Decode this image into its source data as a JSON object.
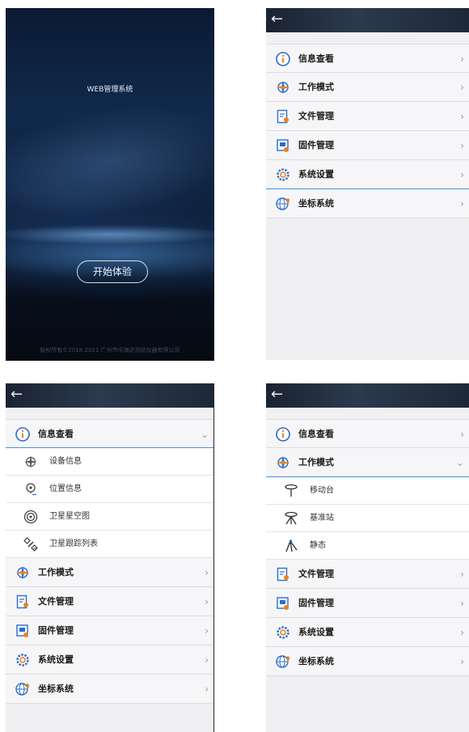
{
  "splash": {
    "system_name": "WEB管理系统",
    "start_button": "开始体验",
    "copyright": "版权所有©2018-2021 广州市中海达测绘仪器有限公司"
  },
  "nav": {
    "back_icon": "←"
  },
  "menu": {
    "items": [
      {
        "label": "信息查看",
        "icon": "info-icon"
      },
      {
        "label": "工作模式",
        "icon": "compass-icon"
      },
      {
        "label": "文件管理",
        "icon": "file-icon"
      },
      {
        "label": "固件管理",
        "icon": "firmware-icon"
      },
      {
        "label": "系统设置",
        "icon": "settings-icon"
      },
      {
        "label": "坐标系统",
        "icon": "globe-icon"
      }
    ],
    "info_sub": [
      {
        "label": "设备信息",
        "icon": "device-icon"
      },
      {
        "label": "位置信息",
        "icon": "location-icon"
      },
      {
        "label": "卫星星空图",
        "icon": "skyplot-icon"
      },
      {
        "label": "卫星跟踪列表",
        "icon": "satellite-icon"
      }
    ],
    "mode_sub": [
      {
        "label": "移动台",
        "icon": "rover-icon"
      },
      {
        "label": "基准站",
        "icon": "base-station-icon"
      },
      {
        "label": "静态",
        "icon": "static-icon"
      }
    ]
  },
  "colors": {
    "accent": "#4a90d9",
    "header": "#1e2838"
  }
}
